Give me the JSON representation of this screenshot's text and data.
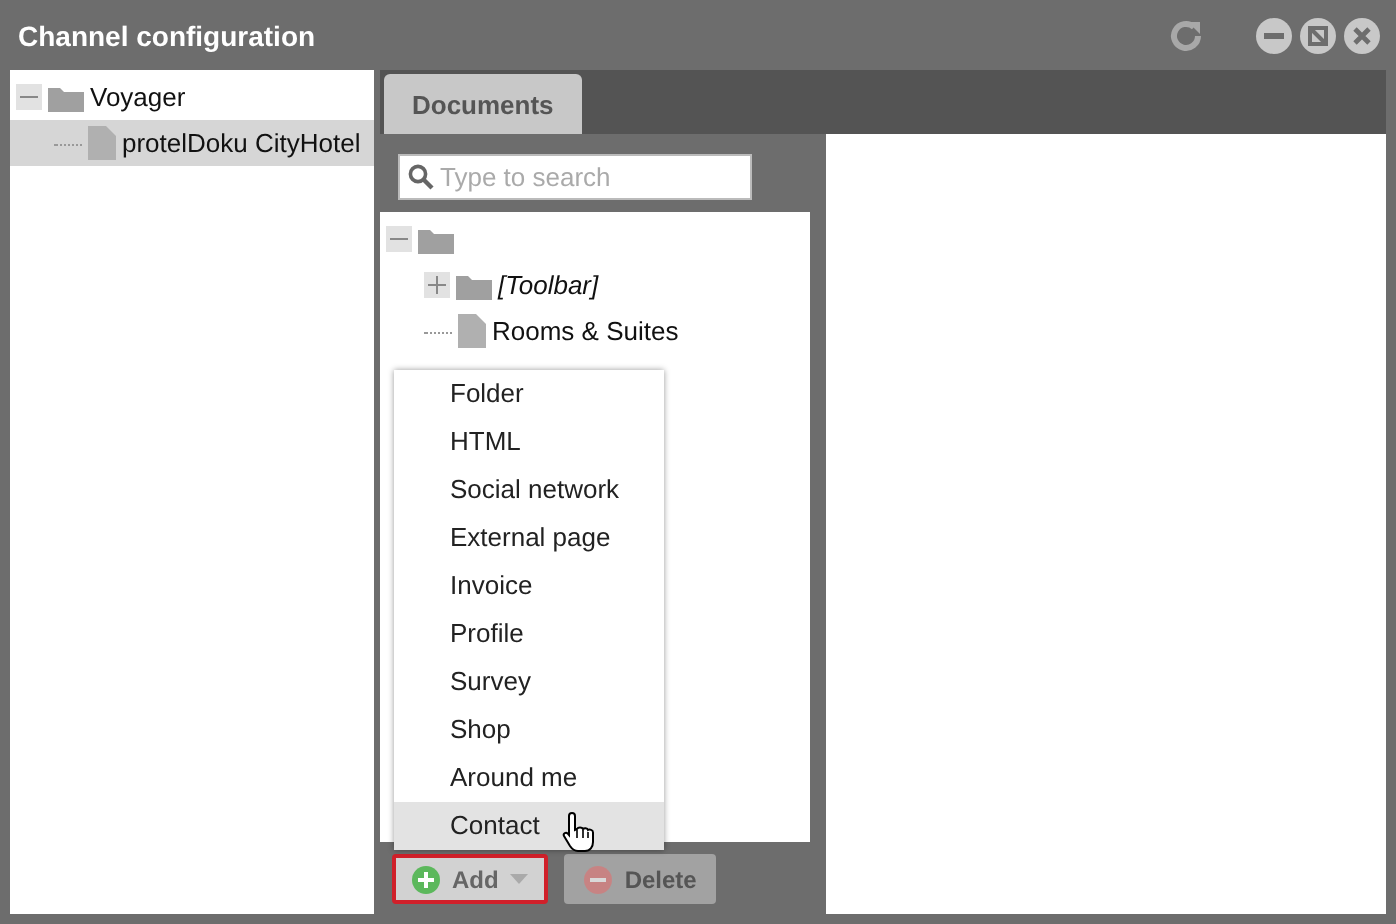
{
  "window": {
    "title": "Channel configuration"
  },
  "channel_tree": [
    {
      "label": "Voyager",
      "kind": "folder",
      "expanded": true,
      "selected": false,
      "children": [
        {
          "label": "protelDoku CityHotel",
          "kind": "document",
          "selected": true
        }
      ]
    }
  ],
  "tabs": [
    {
      "label": "Documents",
      "selected": true
    }
  ],
  "search": {
    "placeholder": "Type to search"
  },
  "document_tree": [
    {
      "kind": "folder",
      "expanded": true,
      "children": [
        {
          "label": "[Toolbar]",
          "kind": "folder",
          "expanded": false,
          "italic": true
        },
        {
          "label": "Rooms & Suites",
          "kind": "document",
          "italic": false
        }
      ]
    }
  ],
  "add_menu": [
    {
      "label": "Folder",
      "selected": false
    },
    {
      "label": "HTML",
      "selected": false
    },
    {
      "label": "Social network",
      "selected": false
    },
    {
      "label": "External page",
      "selected": false
    },
    {
      "label": "Invoice",
      "selected": false
    },
    {
      "label": "Profile",
      "selected": false
    },
    {
      "label": "Survey",
      "selected": false
    },
    {
      "label": "Shop",
      "selected": false
    },
    {
      "label": "Around me",
      "selected": false
    },
    {
      "label": "Contact",
      "selected": true
    }
  ],
  "buttons": [
    {
      "label": "Add",
      "kind": "add",
      "focused": true,
      "disabled": false
    },
    {
      "label": "Delete",
      "kind": "delete",
      "focused": false,
      "disabled": true
    }
  ]
}
